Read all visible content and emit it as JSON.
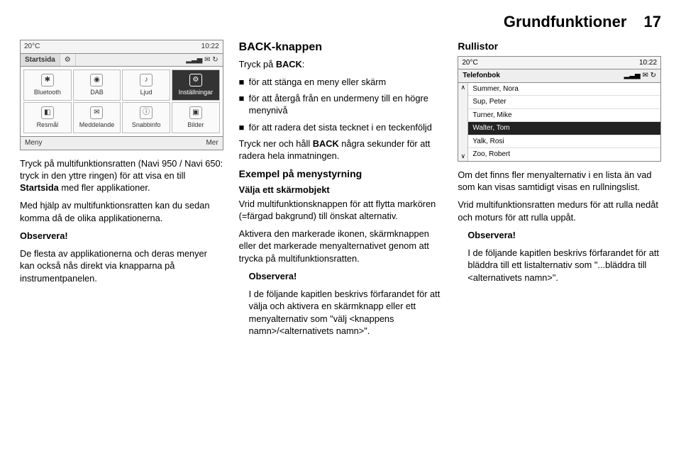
{
  "header": {
    "title": "Grundfunktioner",
    "page": "17"
  },
  "screen1": {
    "status_left": "20°C",
    "status_right": "10:22",
    "tab_left": "Startsida",
    "tab_icons": "⚙",
    "signal": "▂▃▅ ✉ ↻",
    "grid": [
      {
        "icon": "✱",
        "label": "Bluetooth"
      },
      {
        "icon": "◉",
        "label": "DAB"
      },
      {
        "icon": "♪",
        "label": "Ljud"
      },
      {
        "icon": "⚙",
        "label": "Inställningar",
        "selected": true
      },
      {
        "icon": "◧",
        "label": "Resmål"
      },
      {
        "icon": "✉",
        "label": "Meddelande"
      },
      {
        "icon": "ⓘ",
        "label": "Snabbinfo"
      },
      {
        "icon": "▣",
        "label": "Bilder"
      }
    ],
    "bottom_left": "Meny",
    "bottom_right": "Mer"
  },
  "col1": {
    "p1_a": "Tryck på multifunktionsratten (Navi 950 / Navi 650: tryck in den yttre ringen) för att visa en till ",
    "p1_b": "Startsida",
    "p1_c": " med fler applikationer.",
    "p2": "Med hjälp av multifunktionsratten kan du sedan komma då de olika applikationerna.",
    "obs_label": "Observera!",
    "obs_text": "De flesta av applikationerna och deras menyer kan också nås direkt via knapparna på instrumentpanelen."
  },
  "col2": {
    "h2": "BACK-knappen",
    "intro_a": "Tryck på ",
    "intro_b": "BACK",
    "intro_c": ":",
    "b1": "för att stänga en meny eller skärm",
    "b2": "för att återgå från en undermeny till en högre menynivå",
    "b3": "för att radera det sista tecknet i en teckenföljd",
    "hold_a": "Tryck ner och håll ",
    "hold_b": "BACK",
    "hold_c": " några sekunder för att radera hela inmatningen.",
    "h3": "Exempel på menystyrning",
    "h4": "Välja ett skärmobjekt",
    "sel1": "Vrid multifunktionsknappen för att flytta markören (=färgad bakgrund) till önskat alternativ.",
    "sel2": "Aktivera den markerade ikonen, skärmknappen eller det markerade menyalternativet genom att trycka på multifunktionsratten.",
    "obs_label": "Observera!",
    "obs_text": "I de följande kapitlen beskrivs förfarandet för att välja och aktivera en skärmknapp eller ett menyalternativ som \"välj <knappens namn>/<alternativets namn>\"."
  },
  "col3": {
    "h3": "Rullistor",
    "screen2": {
      "status_left": "20°C",
      "status_right": "10:22",
      "title": "Telefonbok",
      "signal": "▂▃▅ ✉ ↻",
      "up": "∧",
      "down": "∨",
      "items": [
        {
          "label": "Summer, Nora"
        },
        {
          "label": "Sup, Peter"
        },
        {
          "label": "Turner, Mike"
        },
        {
          "label": "Walter, Tom",
          "selected": true
        },
        {
          "label": "Yalk, Rosi"
        },
        {
          "label": "Zoo, Robert"
        }
      ]
    },
    "p1": "Om det finns fler menyalternativ i en lista än vad som kan visas samtidigt visas en rullningslist.",
    "p2": "Vrid multifunktionsratten medurs för att rulla nedåt och moturs för att rulla uppåt.",
    "obs_label": "Observera!",
    "obs_text": "I de följande kapitlen beskrivs förfarandet för att bläddra till ett listalternativ som \"...bläddra till <alternativets namn>\"."
  }
}
